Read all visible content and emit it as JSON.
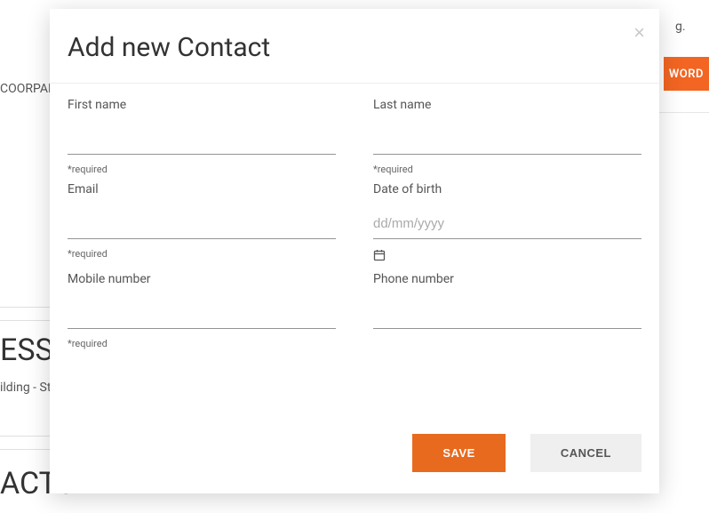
{
  "background": {
    "coorpar": "COORPAR",
    "orange_btn_fragment": "WORD",
    "ess": "ESS",
    "ilding": "ilding - St",
    "acts": "ACTS",
    "dotline_fragment": "g."
  },
  "modal": {
    "title": "Add new Contact",
    "close_symbol": "×",
    "fields": {
      "first_name": {
        "label": "First name",
        "value": "",
        "hint": "*required"
      },
      "last_name": {
        "label": "Last name",
        "value": "",
        "hint": "*required"
      },
      "email": {
        "label": "Email",
        "value": "",
        "hint": "*required"
      },
      "dob": {
        "label": "Date of birth",
        "value": "",
        "placeholder": "dd/mm/yyyy"
      },
      "mobile": {
        "label": "Mobile number",
        "value": "",
        "hint": "*required"
      },
      "phone": {
        "label": "Phone number",
        "value": ""
      }
    },
    "buttons": {
      "save": "SAVE",
      "cancel": "CANCEL"
    }
  }
}
